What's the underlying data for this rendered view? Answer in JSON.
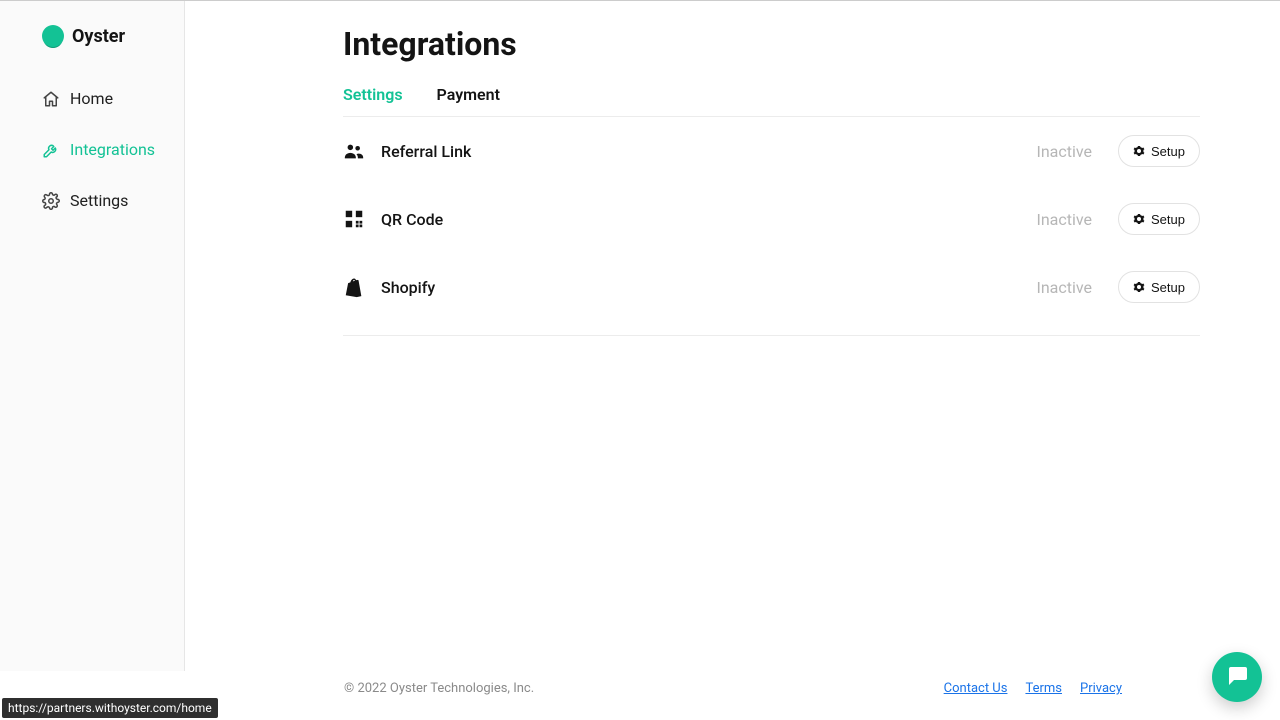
{
  "brand": {
    "name": "Oyster"
  },
  "sidebar": {
    "items": [
      {
        "label": "Home"
      },
      {
        "label": "Integrations"
      },
      {
        "label": "Settings"
      }
    ],
    "activeIndex": 1
  },
  "page": {
    "title": "Integrations"
  },
  "tabs": {
    "items": [
      {
        "label": "Settings"
      },
      {
        "label": "Payment"
      }
    ],
    "activeIndex": 0
  },
  "integrations": [
    {
      "name": "Referral Link",
      "status": "Inactive",
      "action": "Setup",
      "icon": "people-icon"
    },
    {
      "name": "QR Code",
      "status": "Inactive",
      "action": "Setup",
      "icon": "qr-icon"
    },
    {
      "name": "Shopify",
      "status": "Inactive",
      "action": "Setup",
      "icon": "shopify-icon"
    }
  ],
  "footer": {
    "copyright": "© 2022 Oyster Technologies, Inc.",
    "links": [
      {
        "label": "Contact Us"
      },
      {
        "label": "Terms"
      },
      {
        "label": "Privacy"
      }
    ]
  },
  "statusBar": {
    "url": "https://partners.withoyster.com/home"
  },
  "colors": {
    "accent": "#13c295",
    "link": "#1a73e8",
    "muted": "#b6b6b6"
  }
}
